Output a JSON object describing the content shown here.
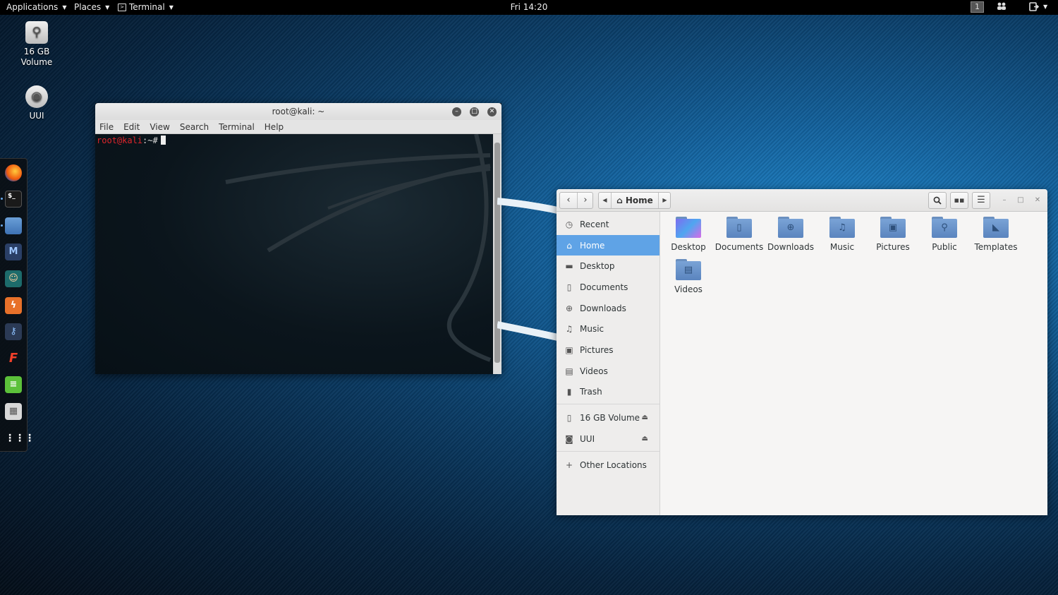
{
  "topbar": {
    "applications": "Applications",
    "places": "Places",
    "terminal": "Terminal",
    "clock": "Fri 14:20",
    "workspace": "1"
  },
  "desktop_icons": [
    {
      "label_line1": "16 GB",
      "label_line2": "Volume",
      "icon": "usb-drive-icon"
    },
    {
      "label_line1": "UUI",
      "label_line2": "",
      "icon": "disk-icon"
    }
  ],
  "dock": {
    "apps": [
      "firefox-icon",
      "terminal-icon",
      "files-icon",
      "metasploit-icon",
      "armitage-icon",
      "burpsuite-icon",
      "beef-icon",
      "faraday-icon",
      "notes-icon",
      "cherrytree-icon",
      "show-apps-icon"
    ]
  },
  "terminal": {
    "title": "root@kali: ~",
    "menu": [
      "File",
      "Edit",
      "View",
      "Search",
      "Terminal",
      "Help"
    ],
    "prompt_user": "root@kali",
    "prompt_path": ":~#"
  },
  "files": {
    "path_label": "Home",
    "sidebar": [
      {
        "label": "Recent",
        "icon": "clock-icon"
      },
      {
        "label": "Home",
        "icon": "home-icon",
        "active": true
      },
      {
        "label": "Desktop",
        "icon": "desktop-folder-icon"
      },
      {
        "label": "Documents",
        "icon": "document-icon"
      },
      {
        "label": "Downloads",
        "icon": "download-icon"
      },
      {
        "label": "Music",
        "icon": "music-icon"
      },
      {
        "label": "Pictures",
        "icon": "pictures-icon"
      },
      {
        "label": "Videos",
        "icon": "video-icon"
      },
      {
        "label": "Trash",
        "icon": "trash-icon"
      }
    ],
    "devices": [
      {
        "label": "16 GB Volume",
        "icon": "usb-drive-icon"
      },
      {
        "label": "UUI",
        "icon": "disk-icon"
      }
    ],
    "other_locations": "Other Locations",
    "folders": [
      "Desktop",
      "Documents",
      "Downloads",
      "Music",
      "Pictures",
      "Public",
      "Templates",
      "Videos"
    ]
  }
}
